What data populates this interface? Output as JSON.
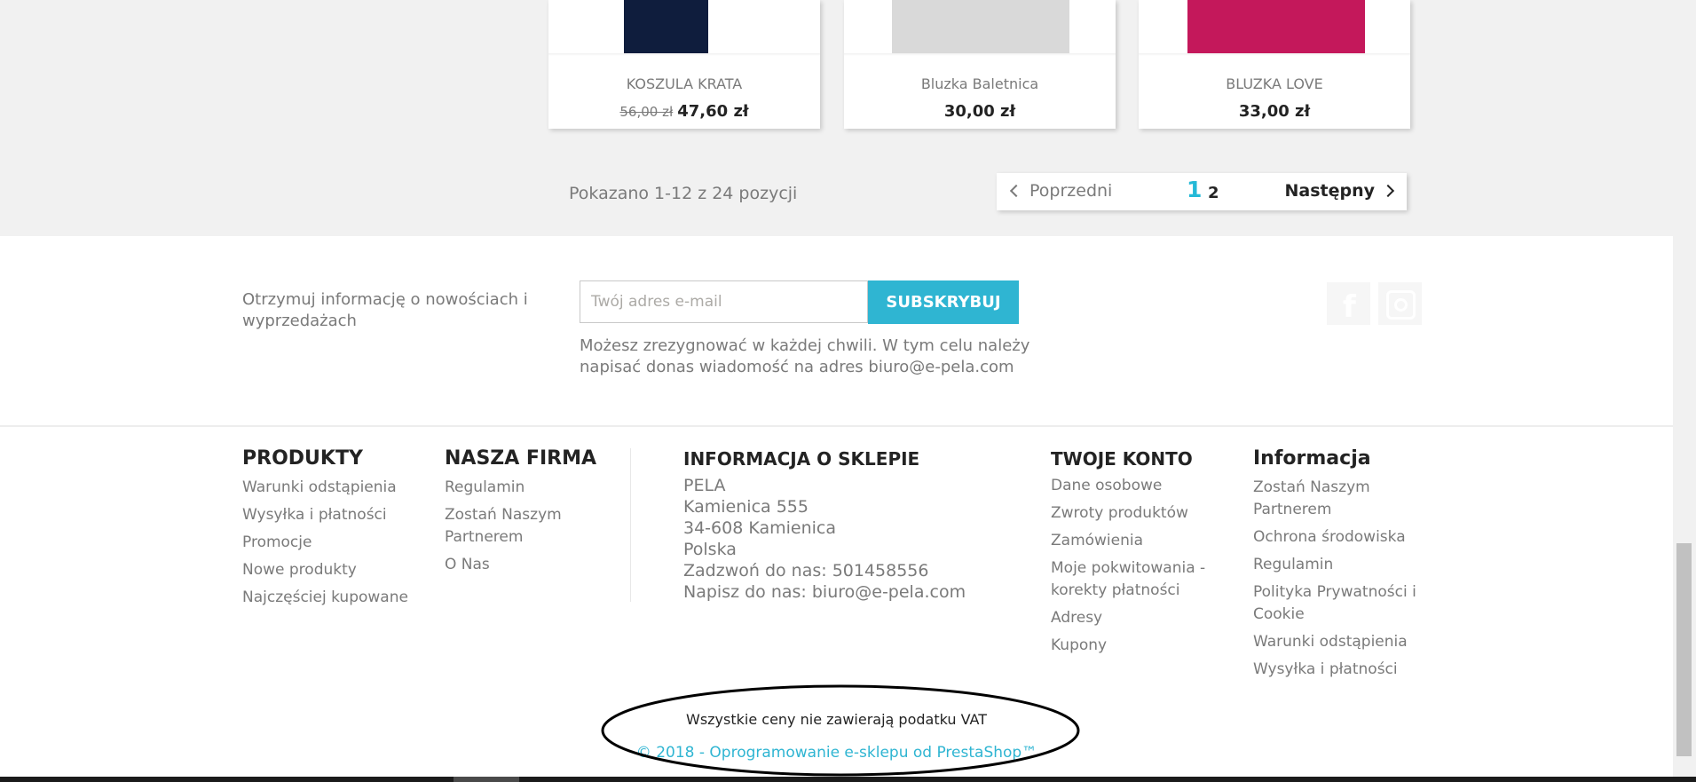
{
  "products": [
    {
      "name": "KOSZULA KRATA",
      "old_price": "56,00 zł",
      "price": "47,60 zł",
      "thumb_color": "#0f1d3d"
    },
    {
      "name": "Bluzka Baletnica",
      "old_price": "",
      "price": "30,00 zł",
      "thumb_color": "#d9d9d9"
    },
    {
      "name": "BLUZKA LOVE",
      "old_price": "",
      "price": "33,00 zł",
      "thumb_color": "#c4185b"
    }
  ],
  "pagination": {
    "summary": "Pokazano 1-12 z 24 pozycji",
    "prev_label": "Poprzedni",
    "next_label": "Następny",
    "current_page": "1",
    "other_page": "2"
  },
  "newsletter": {
    "text": "Otrzymuj informację o nowościach i wyprzedażach",
    "email_placeholder": "Twój adres e-mail",
    "subscribe_label": "SUBSKRYBUJ",
    "conditions": "Możesz zrezygnować w każdej chwili. W tym celu należy napisać donas wiadomość na adres biuro@e-pela.com"
  },
  "social": {
    "facebook": "facebook-icon",
    "instagram": "instagram-icon"
  },
  "footer": {
    "products": {
      "title": "PRODUKTY",
      "links": [
        "Warunki odstąpienia",
        "Wysyłka i płatności",
        "Promocje",
        "Nowe produkty",
        "Najczęściej kupowane"
      ]
    },
    "company": {
      "title": "NASZA FIRMA",
      "links": [
        "Regulamin",
        "Zostań Naszym Partnerem",
        "O Nas"
      ]
    },
    "store_info": {
      "title": "INFORMACJA O SKLEPIE",
      "lines": [
        "PELA",
        "Kamienica 555",
        "34-608 Kamienica",
        "Polska",
        "Zadzwoń do nas: 501458556",
        "Napisz do nas: biuro@e-pela.com"
      ]
    },
    "account": {
      "title": "TWOJE KONTO",
      "links": [
        "Dane osobowe",
        "Zwroty produktów",
        "Zamówienia",
        "Moje pokwitowania - korekty płatności",
        "Adresy",
        "Kupony"
      ]
    },
    "info": {
      "title": "Informacja",
      "links": [
        "Zostań Naszym Partnerem",
        "Ochrona środowiska",
        "Regulamin",
        "Polityka Prywatności i Cookie",
        "Warunki odstąpienia",
        "Wysyłka i płatności"
      ]
    },
    "vat_note": "Wszystkie ceny nie zawierają podatku VAT",
    "copyright": "© 2018 - Oprogramowanie e-sklepu od PrestaShop™"
  },
  "colors": {
    "accent": "#2fb5d2",
    "page_bg_grey": "#f1f1f1",
    "annotation_ellipse": "#000000"
  }
}
